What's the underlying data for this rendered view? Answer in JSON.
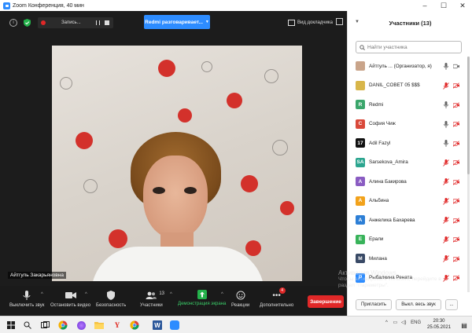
{
  "window": {
    "title": "Zoom Конференция, 40 мин"
  },
  "topbar": {
    "recording_label": "Запись...",
    "speaker_label": "Redmi разговаривает...",
    "view_label": "Вид докладчика"
  },
  "video": {
    "name_tag": "Айтгуль Закарьяновна"
  },
  "toolbar": {
    "mute_label": "Выключить звук",
    "video_label": "Остановить видео",
    "security_label": "Безопасность",
    "participants_label": "Участники",
    "participants_count": "13",
    "share_label": "Демонстрация экрана",
    "reactions_label": "Реакции",
    "more_label": "Дополнительно",
    "more_badge": "4",
    "end_label": "Завершение"
  },
  "panel": {
    "title": "Участники (13)",
    "search_placeholder": "Найти участника",
    "participants": [
      {
        "name": "Айтгуль ...  (Организатор, я)",
        "initial": "",
        "color": "#c9a48a",
        "mic": "on",
        "cam": "on"
      },
      {
        "name": "DANIL_СОВЕТ 05 $$$",
        "initial": "",
        "color": "#d8b64a",
        "mic": "muted",
        "cam": "off"
      },
      {
        "name": "Redmi",
        "initial": "R",
        "color": "#3aa66b",
        "mic": "on",
        "cam": "off"
      },
      {
        "name": "София Чиж",
        "initial": "С",
        "color": "#d9493a",
        "mic": "on",
        "cam": "off"
      },
      {
        "name": "Adil Fazyl",
        "initial": "17",
        "color": "#111111",
        "mic": "on",
        "cam": "off"
      },
      {
        "name": "Sarsekova_Amira",
        "initial": "SA",
        "color": "#2ba58f",
        "mic": "muted",
        "cam": "off"
      },
      {
        "name": "Алина Бакирова",
        "initial": "А",
        "color": "#8a5cc2",
        "mic": "muted",
        "cam": "off"
      },
      {
        "name": "Альбина",
        "initial": "А",
        "color": "#f2a21b",
        "mic": "muted",
        "cam": "off"
      },
      {
        "name": "Анжелика Бахарева",
        "initial": "А",
        "color": "#2d7fd6",
        "mic": "muted",
        "cam": "off"
      },
      {
        "name": "Ерали",
        "initial": "Е",
        "color": "#38b35a",
        "mic": "muted",
        "cam": "off"
      },
      {
        "name": "Милана",
        "initial": "М",
        "color": "#394a66",
        "mic": "muted",
        "cam": "off"
      },
      {
        "name": "Рыбалкина Рената",
        "initial": "Р",
        "color": "#2d8cff",
        "mic": "muted",
        "cam": "off"
      }
    ],
    "invite_label": "Пригласить",
    "mute_all_label": "Выкл. весь звук",
    "more_label": "..."
  },
  "watermark": {
    "line1": "Активация Windows",
    "line2": "Чтобы активировать Windows, перейдите в",
    "line3": "раздел \"Параметры\"."
  },
  "taskbar": {
    "lang": "ENG",
    "time": "20:30",
    "date": "25.05.2021"
  },
  "colors": {
    "accent": "#2d8cff",
    "end": "#e02828"
  }
}
